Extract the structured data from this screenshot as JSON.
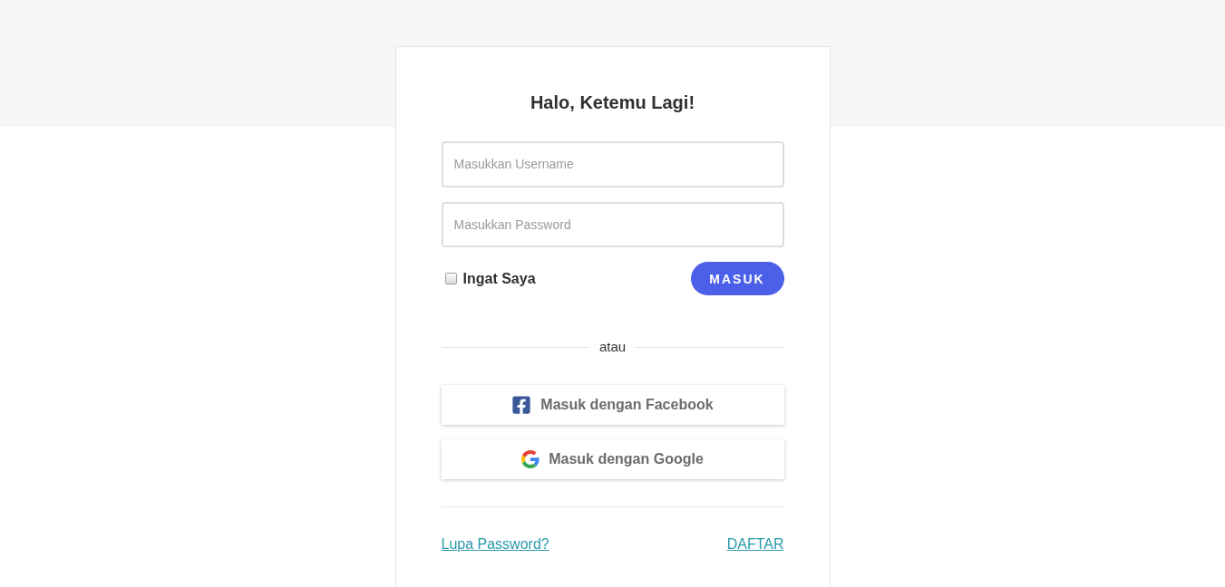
{
  "title": "Halo, Ketemu Lagi!",
  "fields": [
    {
      "placeholder": "Masukkan Username"
    },
    {
      "placeholder": "Masukkan Password"
    }
  ],
  "remember": {
    "label": "Ingat Saya",
    "checked": false
  },
  "submit": {
    "label": "MASUK"
  },
  "divider": {
    "label": "atau"
  },
  "social_buttons": [
    {
      "kind": "facebook",
      "label": "Masuk dengan Facebook"
    },
    {
      "kind": "google",
      "label": "Masuk dengan Google"
    }
  ],
  "links": [
    {
      "label": "Lupa Password?"
    },
    {
      "label": "DAFTAR"
    }
  ]
}
